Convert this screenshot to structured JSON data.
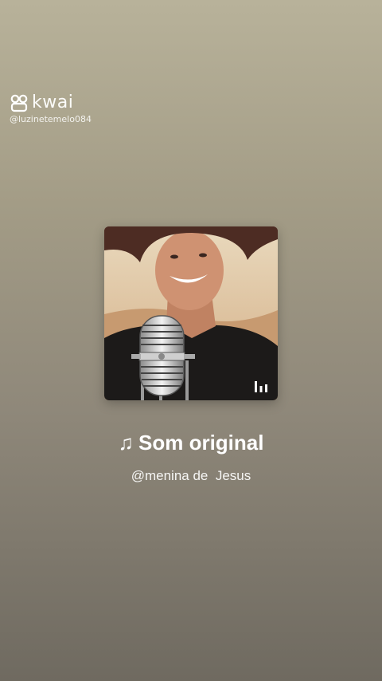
{
  "watermark": {
    "app_name": "kwai",
    "handle": "@luzinetemelo084"
  },
  "player": {
    "song_title": "Som original",
    "artist": "@menina de  Jesus",
    "note_icon": "music-note-icon",
    "playing_icon": "audio-bars-icon"
  }
}
